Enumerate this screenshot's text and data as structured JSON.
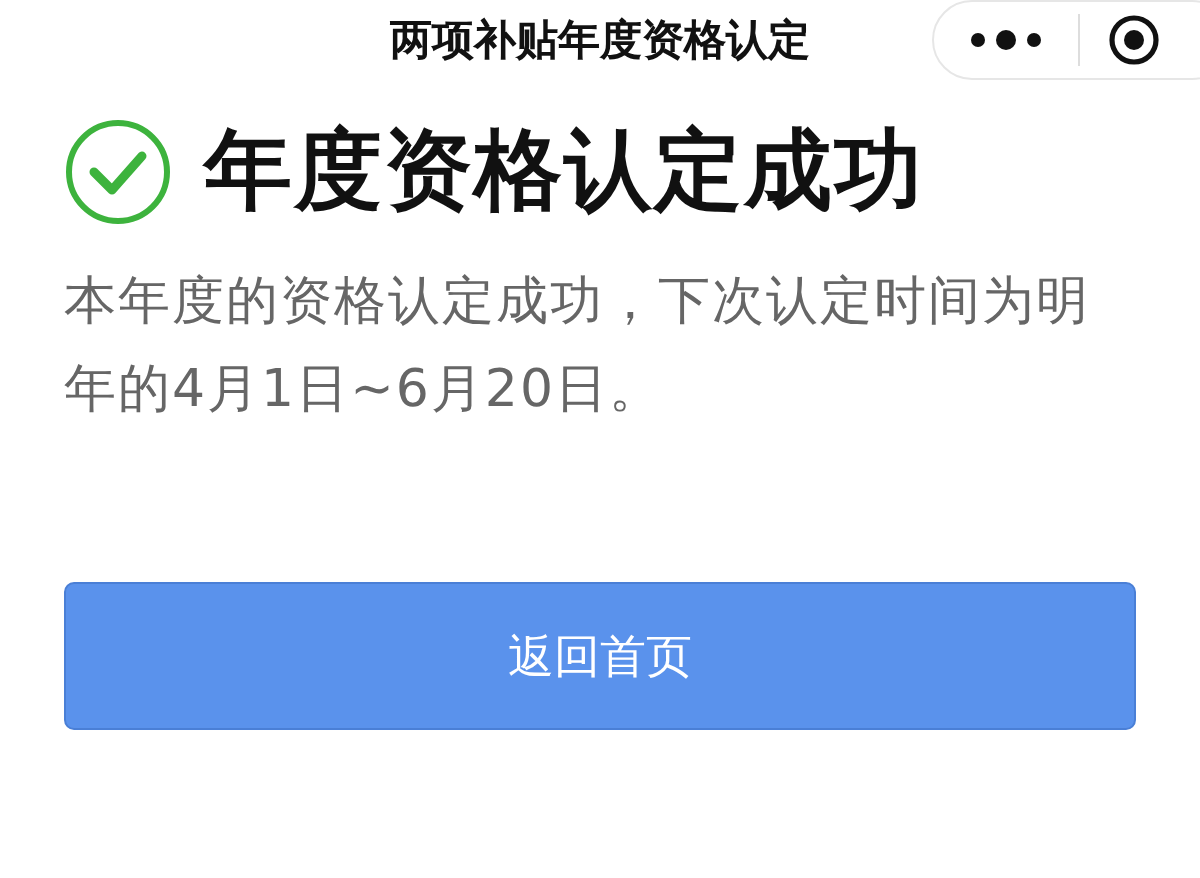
{
  "nav_bar": {
    "title": "两项补贴年度资格认定"
  },
  "result": {
    "succeeded": true,
    "heading": "年度资格认定成功",
    "message": "本年度的资格认定成功，下次认定时间为明年的4月1日~6月20日。"
  },
  "buttons": [
    "返回首页"
  ]
}
